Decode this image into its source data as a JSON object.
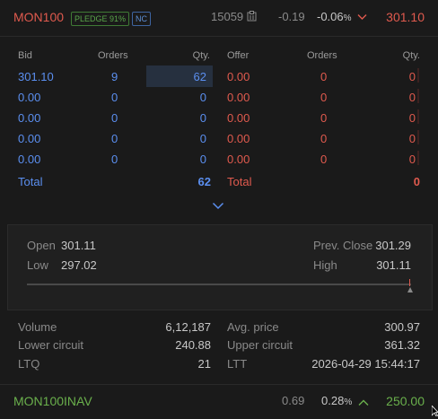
{
  "header": {
    "symbol": "MON100",
    "pledge_badge": "PLEDGE 91%",
    "nc_badge": "NC",
    "volume": "15059",
    "change": "-0.19",
    "change_pct": "-0.06",
    "pct_suffix": "%",
    "ltp": "301.10"
  },
  "depth": {
    "headers": {
      "bid": "Bid",
      "orders": "Orders",
      "qty": "Qty.",
      "offer": "Offer",
      "offer_orders": "Orders",
      "offer_qty": "Qty."
    },
    "rows": [
      {
        "bid": "301.10",
        "bid_orders": "9",
        "bid_qty": "62",
        "offer": "0.00",
        "offer_orders": "0",
        "offer_qty": "0"
      },
      {
        "bid": "0.00",
        "bid_orders": "0",
        "bid_qty": "0",
        "offer": "0.00",
        "offer_orders": "0",
        "offer_qty": "0"
      },
      {
        "bid": "0.00",
        "bid_orders": "0",
        "bid_qty": "0",
        "offer": "0.00",
        "offer_orders": "0",
        "offer_qty": "0"
      },
      {
        "bid": "0.00",
        "bid_orders": "0",
        "bid_qty": "0",
        "offer": "0.00",
        "offer_orders": "0",
        "offer_qty": "0"
      },
      {
        "bid": "0.00",
        "bid_orders": "0",
        "bid_qty": "0",
        "offer": "0.00",
        "offer_orders": "0",
        "offer_qty": "0"
      }
    ],
    "total_label": "Total",
    "bid_total": "62",
    "offer_total_label": "Total",
    "offer_total": "0"
  },
  "ohlc": {
    "open_label": "Open",
    "open": "301.11",
    "prev_close_label": "Prev. Close",
    "prev_close": "301.29",
    "low_label": "Low",
    "low": "297.02",
    "high_label": "High",
    "high": "301.11"
  },
  "stats": {
    "volume_label": "Volume",
    "volume": "6,12,187",
    "avg_price_label": "Avg. price",
    "avg_price": "300.97",
    "lower_circuit_label": "Lower circuit",
    "lower_circuit": "240.88",
    "upper_circuit_label": "Upper circuit",
    "upper_circuit": "361.32",
    "ltq_label": "LTQ",
    "ltq": "21",
    "ltt_label": "LTT",
    "ltt": "2026-04-29 15:44:17"
  },
  "footer": {
    "symbol": "MON100INAV",
    "change": "0.69",
    "change_pct": "0.28",
    "pct_suffix": "%",
    "ltp": "250.00"
  },
  "colors": {
    "down": "#e05a4e",
    "up": "#6ab04c",
    "bid": "#5b8ff0"
  }
}
